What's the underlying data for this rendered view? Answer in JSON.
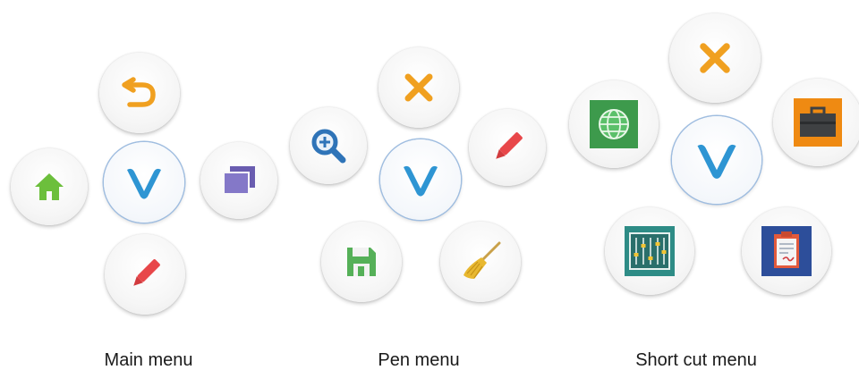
{
  "menus": {
    "main": {
      "label": "Main menu",
      "icons": {
        "center": "v-logo-icon",
        "top": "undo-icon",
        "left": "home-icon",
        "right": "windows-icon",
        "bottom": "pen-icon"
      }
    },
    "pen": {
      "label": "Pen menu",
      "icons": {
        "center": "v-logo-icon",
        "top": "close-icon",
        "left": "zoom-in-icon",
        "right": "pen-icon",
        "bottom_left": "save-icon",
        "bottom_right": "broom-icon"
      }
    },
    "shortcut": {
      "label": "Short cut menu",
      "icons": {
        "center": "v-logo-icon",
        "top": "close-icon",
        "left": "globe-icon",
        "right": "briefcase-icon",
        "bottom_left": "equalizer-icon",
        "bottom_right": "clipboard-icon"
      }
    }
  },
  "colors": {
    "v_logo": "#2e95d3",
    "close": "#f0a020",
    "undo": "#f0a020",
    "home": "#6cbf3c",
    "windows": "#7a6dc0",
    "pen": "#e8474a",
    "zoom": "#2f74b8",
    "save": "#55b058",
    "broom": "#e8b830",
    "globe_bg": "#3d9a4c",
    "briefcase_bg": "#ef8a12",
    "equalizer_bg": "#2e8c86",
    "clipboard_bg": "#2d4e9a"
  }
}
